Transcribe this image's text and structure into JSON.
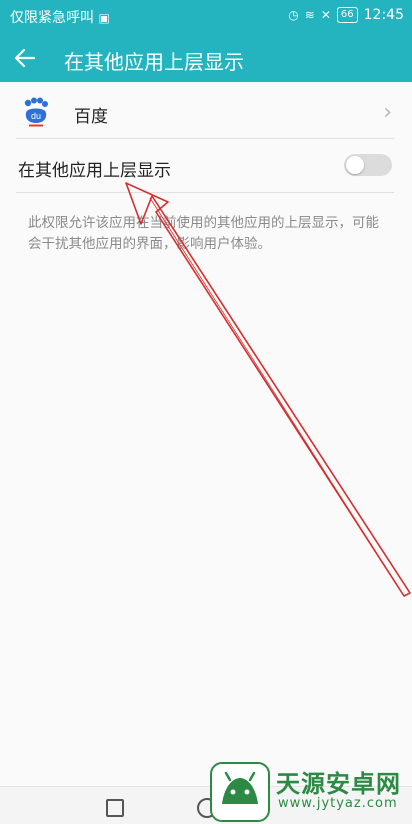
{
  "statusbar": {
    "left_text": "仅限紧急呼叫",
    "battery": "66",
    "time": "12:45"
  },
  "toolbar": {
    "title": "在其他应用上层显示"
  },
  "app": {
    "name": "百度",
    "icon_text": "du"
  },
  "setting": {
    "label": "在其他应用上层显示",
    "enabled": false
  },
  "description": "此权限允许该应用在当前使用的其他应用的上层显示，可能会干扰其他应用的界面，影响用户体验。",
  "watermark": {
    "title": "天源安卓网",
    "url": "www.jytyaz.com"
  },
  "colors": {
    "accent": "#24b4c0",
    "annotation_arrow": "#d32f2f",
    "watermark": "#2d8a44"
  },
  "icons": [
    "back-arrow-icon",
    "chevron-right-icon",
    "baidu-paw-icon",
    "wifi-icon",
    "alarm-icon",
    "battery-icon"
  ]
}
